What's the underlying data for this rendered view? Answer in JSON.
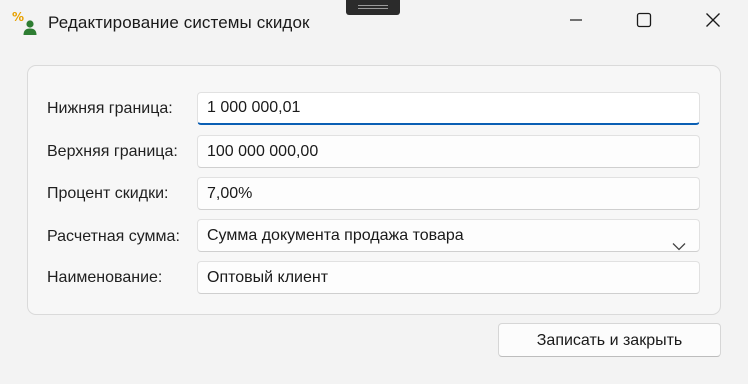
{
  "window": {
    "title": "Редактирование системы скидок",
    "icon": "percent-user-icon",
    "controls": [
      "minimize-icon",
      "maximize-icon",
      "close-icon"
    ]
  },
  "form": {
    "lower_bound": {
      "label": "Нижняя граница:",
      "value": "1 000 000,01"
    },
    "upper_bound": {
      "label": "Верхняя граница:",
      "value": "100 000 000,00"
    },
    "discount_percent": {
      "label": "Процент скидки:",
      "value": "7,00%"
    },
    "calc_amount": {
      "label": "Расчетная сумма:",
      "value": "Сумма документа продажа товара"
    },
    "name": {
      "label": "Наименование:",
      "value": "Оптовый клиент"
    }
  },
  "actions": {
    "save_close_label": "Записать и закрыть"
  },
  "colors": {
    "accent": "#0a5fb4",
    "window_bg": "#f3f3f3",
    "icon_orange": "#e8a100",
    "icon_green": "#2e7d32"
  }
}
